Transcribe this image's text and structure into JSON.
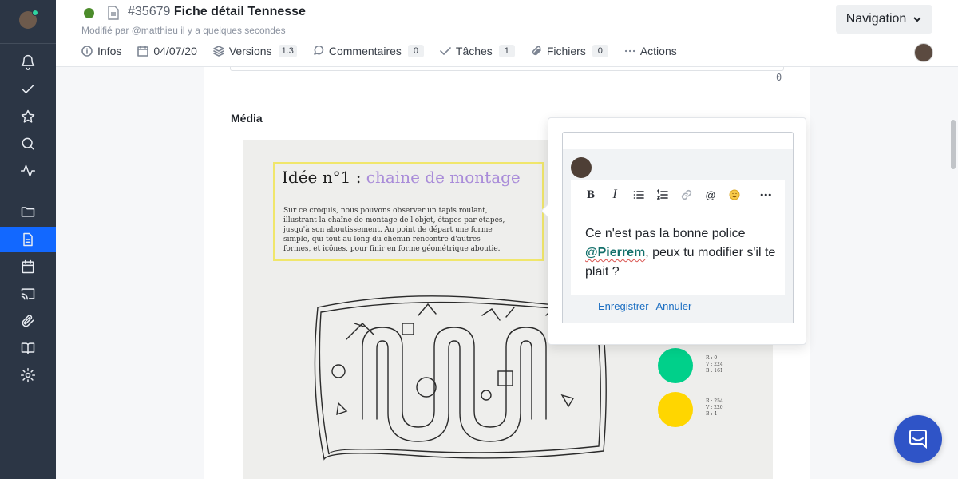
{
  "header": {
    "status_color": "#4c8c2b",
    "doc_number": "#35679",
    "doc_title": "Fiche détail Tennesse",
    "subtitle": "Modifié par @matthieu il y a quelques secondes",
    "navigation_label": "Navigation",
    "tabs": [
      {
        "label": "Infos",
        "icon": "info-icon"
      },
      {
        "label": "04/07/20",
        "icon": "calendar-icon"
      },
      {
        "label": "Versions",
        "icon": "layers-icon",
        "badge": "1.3"
      },
      {
        "label": "Commentaires",
        "icon": "comment-icon",
        "badge": "0"
      },
      {
        "label": "Tâches",
        "icon": "check-icon",
        "badge": "1"
      },
      {
        "label": "Fichiers",
        "icon": "paperclip-icon",
        "badge": "0"
      },
      {
        "label": "Actions",
        "icon": "ellipsis-icon"
      }
    ]
  },
  "sidebar": {
    "accent_color": "#1268ff",
    "items": [
      {
        "icon": "bell-icon"
      },
      {
        "icon": "check-icon"
      },
      {
        "icon": "star-icon"
      },
      {
        "icon": "search-icon"
      },
      {
        "icon": "activity-icon"
      },
      {
        "icon": "folder-icon"
      },
      {
        "icon": "document-icon",
        "active": true
      },
      {
        "icon": "calendar-icon"
      },
      {
        "icon": "cast-icon"
      },
      {
        "icon": "paperclip-icon"
      },
      {
        "icon": "book-icon"
      },
      {
        "icon": "settings-icon"
      }
    ]
  },
  "content": {
    "counter": "0",
    "media_label": "Média",
    "sketch": {
      "title_black": "Idée n°1 : ",
      "title_purple": "chaine de montage",
      "text": "Sur ce croquis, nous pouvons observer un tapis roulant, illustrant la chaîne de montage de l'objet, étapes par étapes, jusqu'à son aboutissement. Au point de départ une forme simple, qui tout au long du chemin rencontre d'autres formes, et icônes, pour finir en forme géométrique aboutie.",
      "swatches": [
        {
          "color": "#00d08a",
          "label": "R : 0\nV : 224\nB : 161"
        },
        {
          "color": "#ffd600",
          "label": "R : 254\nV : 220\nB : 4"
        }
      ]
    }
  },
  "comment_popover": {
    "editor_text_before": "Ce n'est pas la bonne police ",
    "mention": "@Pierrem",
    "editor_text_after": ", peux tu modifier s'il te plait ?",
    "save_label": "Enregistrer",
    "cancel_label": "Annuler",
    "toolbar": [
      "bold-icon",
      "italic-icon",
      "bullet-list-icon",
      "numbered-list-icon",
      "link-icon",
      "at-icon",
      "emoji-icon",
      "more-icon"
    ]
  },
  "chat": {
    "color": "#2f54c7"
  }
}
